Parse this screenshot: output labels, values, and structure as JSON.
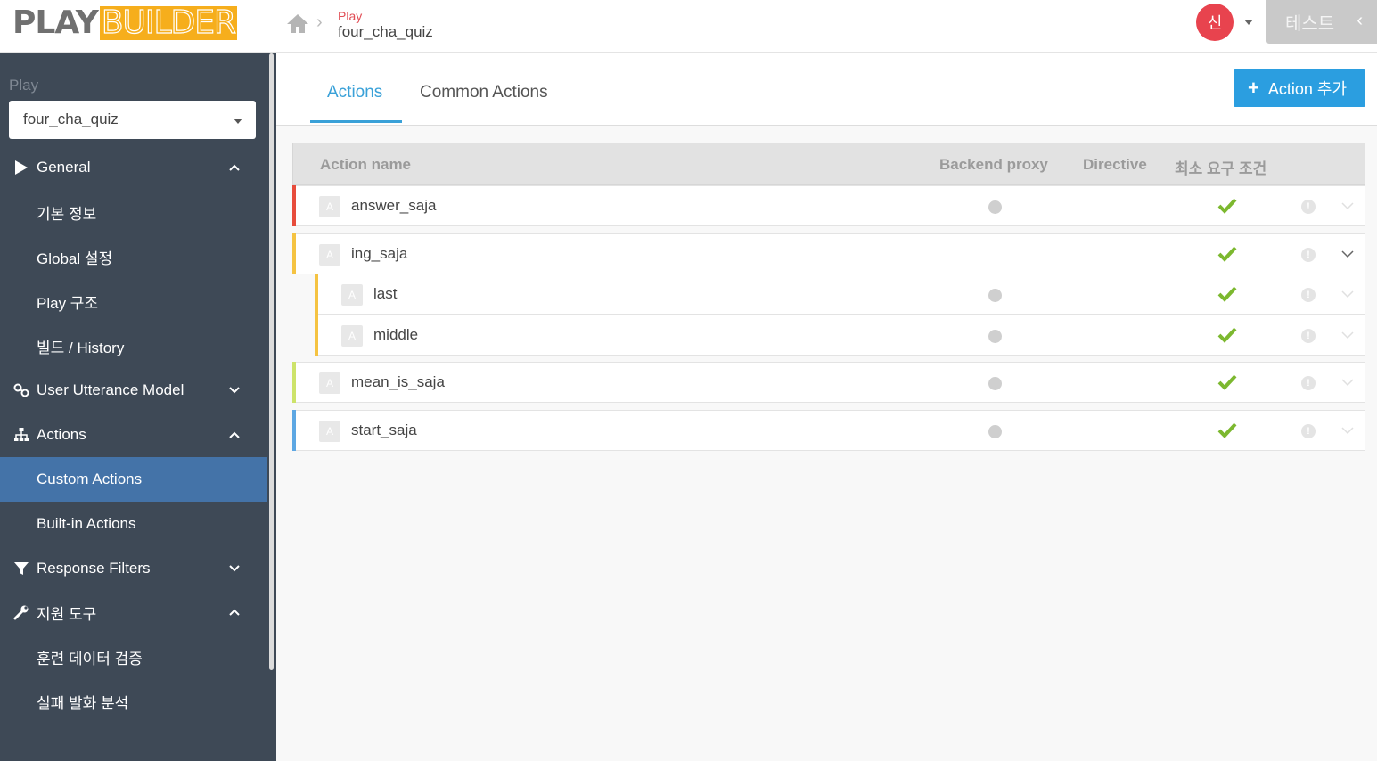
{
  "app": {
    "logo_part1": "PLAY",
    "logo_part2": "BUILDER"
  },
  "breadcrumb": {
    "label": "Play",
    "value": "four_cha_quiz"
  },
  "user": {
    "avatar_initial": "신"
  },
  "header": {
    "test_button_label": "테스트"
  },
  "sidebar": {
    "play_label": "Play",
    "play_select_value": "four_cha_quiz",
    "items": [
      {
        "label": "General",
        "icon": "play-triangle-icon",
        "chevron": "up"
      },
      {
        "label": "기본 정보"
      },
      {
        "label": "Global 설정"
      },
      {
        "label": "Play 구조"
      },
      {
        "label": "빌드 / History"
      },
      {
        "label": "User Utterance Model",
        "icon": "link-icon",
        "chevron": "down"
      },
      {
        "label": "Actions",
        "icon": "sitemap-icon",
        "chevron": "up"
      },
      {
        "label": "Custom Actions",
        "active": true
      },
      {
        "label": "Built-in Actions"
      },
      {
        "label": "Response Filters",
        "icon": "filter-icon",
        "chevron": "down"
      },
      {
        "label": "지원 도구",
        "icon": "wrench-icon",
        "chevron": "up"
      },
      {
        "label": "훈련 데이터 검증"
      },
      {
        "label": "실패 발화 분석"
      }
    ]
  },
  "tabs": {
    "actions": "Actions",
    "common_actions": "Common Actions"
  },
  "add_action_button": "Action 추가",
  "table": {
    "headers": {
      "action_name": "Action name",
      "backend_proxy": "Backend proxy",
      "directive": "Directive",
      "min_requirement": "최소 요구 조건"
    },
    "badge_letter": "A",
    "info_glyph": "!",
    "rows": [
      {
        "name": "answer_saja",
        "color": "#e74c3c",
        "backend_proxy": true,
        "min_requirement": true
      },
      {
        "name": "ing_saja",
        "color": "#f5c342",
        "backend_proxy": false,
        "min_requirement": true,
        "expanded": true
      },
      {
        "name": "last",
        "color": "#f5c342",
        "child": true,
        "backend_proxy": true,
        "min_requirement": true
      },
      {
        "name": "middle",
        "color": "#f5c342",
        "child": true,
        "backend_proxy": true,
        "min_requirement": true
      },
      {
        "name": "mean_is_saja",
        "color": "#cde36a",
        "backend_proxy": true,
        "min_requirement": true
      },
      {
        "name": "start_saja",
        "color": "#5da7e3",
        "backend_proxy": true,
        "min_requirement": true
      }
    ]
  },
  "colors": {
    "sidebar_bg": "#3e4956",
    "sidebar_active": "#4473a8",
    "accent": "#3aa1d8",
    "primary_button": "#2b9ee0",
    "check_green": "#7cb82f",
    "avatar_red": "#e8434e",
    "logo_orange": "#f6ae1c"
  }
}
